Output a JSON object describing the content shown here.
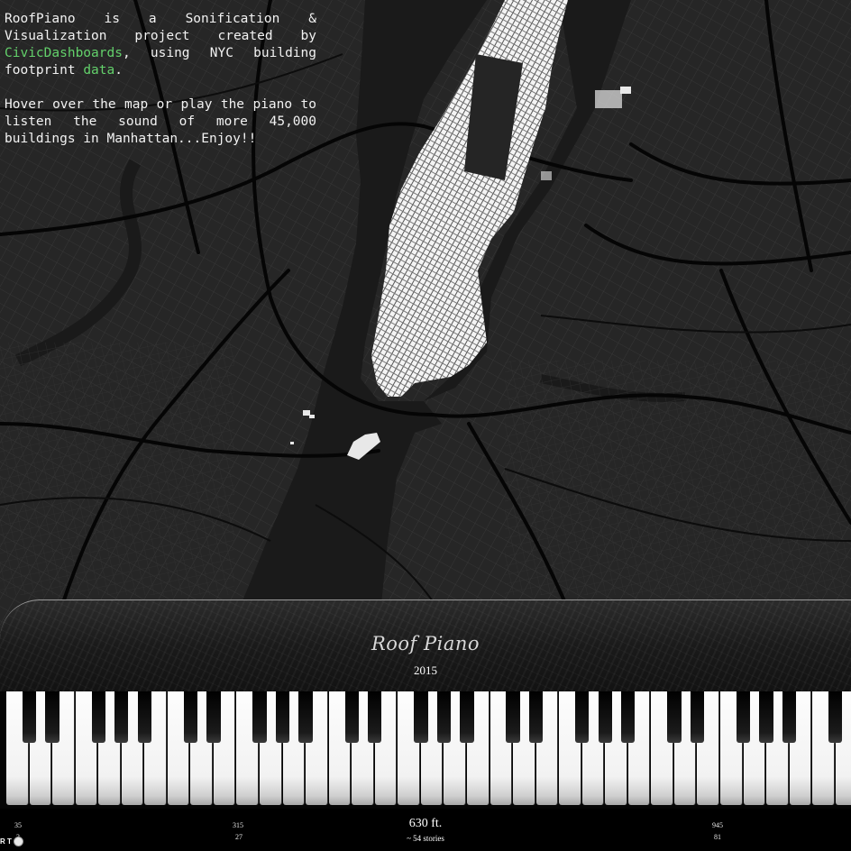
{
  "intro": {
    "p1_before": "RoofPiano is a Sonification & Visualization project created by ",
    "link1": "CivicDashboards",
    "p1_middle": ", using NYC building footprint ",
    "link2": "data",
    "p1_after": ".",
    "p2": "Hover over the map or play the piano to listen the sound of more 45,000 buildings in Manhattan...Enjoy!!"
  },
  "panel": {
    "brand": "Roof Piano",
    "year": "2015"
  },
  "scale": {
    "ticks": [
      {
        "feet": "35",
        "stories": "3"
      },
      {
        "feet": "315",
        "stories": "27"
      },
      {
        "feet": "945",
        "stories": "81"
      }
    ],
    "height": "630 ft.",
    "stories": "~ 54 stories"
  },
  "control": {
    "label": "R T"
  },
  "keyboard": {
    "white_keys": 38,
    "black_pattern": [
      1,
      1,
      0,
      1,
      1,
      1,
      0
    ]
  },
  "colors": {
    "map_bg": "#1e1e1e",
    "link": "#63d16b",
    "buildings": "#ffffff"
  }
}
